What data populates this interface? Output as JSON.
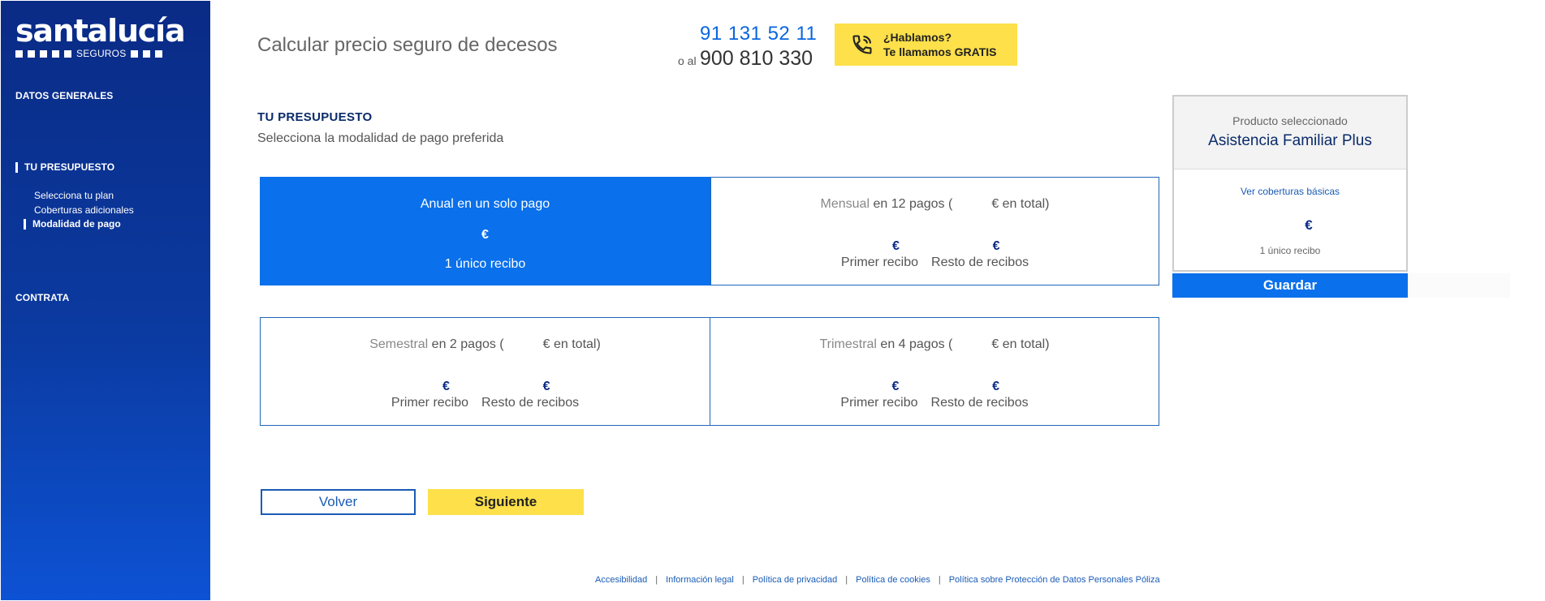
{
  "brand": {
    "name": "santalucía",
    "sub": "SEGUROS"
  },
  "sidebar": {
    "sections": [
      {
        "label": "DATOS GENERALES"
      },
      {
        "label": "TU PRESUPUESTO"
      },
      {
        "label": "CONTRATA"
      }
    ],
    "subitems": [
      {
        "label": "Selecciona tu plan"
      },
      {
        "label": "Coberturas adicionales"
      },
      {
        "label": "Modalidad de pago"
      }
    ]
  },
  "header": {
    "title": "Calcular precio seguro de decesos",
    "phone_primary": "91 131 52 11",
    "phone_secondary_prefix": "o al",
    "phone_secondary": "900 810 330",
    "callback_line1": "¿Hablamos?",
    "callback_line2": "Te llamamos GRATIS"
  },
  "budget": {
    "title": "TU PRESUPUESTO",
    "subtitle": "Selecciona la modalidad de pago preferida",
    "plans": [
      {
        "title": "Anual en un solo pago",
        "euro": "€",
        "note": "1 único recibo",
        "selected": true
      },
      {
        "mode": "Mensual",
        "rest": " en 12 pagos (",
        "total_suffix": "€ en total)",
        "first_euro": "€",
        "rest_euro": "€",
        "first_label": "Primer recibo",
        "rest_label": "Resto de recibos"
      },
      {
        "mode": "Semestral",
        "rest": " en 2 pagos (",
        "total_suffix": "€ en total)",
        "first_euro": "€",
        "rest_euro": "€",
        "first_label": "Primer recibo",
        "rest_label": "Resto de recibos"
      },
      {
        "mode": "Trimestral",
        "rest": " en 4 pagos (",
        "total_suffix": "€ en total)",
        "first_euro": "€",
        "rest_euro": "€",
        "first_label": "Primer recibo",
        "rest_label": "Resto de recibos"
      }
    ]
  },
  "summary": {
    "label": "Producto seleccionado",
    "product": "Asistencia Familiar Plus",
    "link": "Ver coberturas básicas",
    "euro": "€",
    "recibo": "1 único recibo",
    "save": "Guardar"
  },
  "actions": {
    "back": "Volver",
    "next": "Siguiente"
  },
  "footer": {
    "links": [
      "Accesibilidad",
      "Información legal",
      "Política de privacidad",
      "Política de cookies",
      "Política sobre Protección de Datos Personales Póliza"
    ],
    "separator": "|"
  },
  "colors": {
    "brand_blue": "#0a2b86",
    "accent_blue": "#0a70eb",
    "yellow": "#fde04a"
  }
}
